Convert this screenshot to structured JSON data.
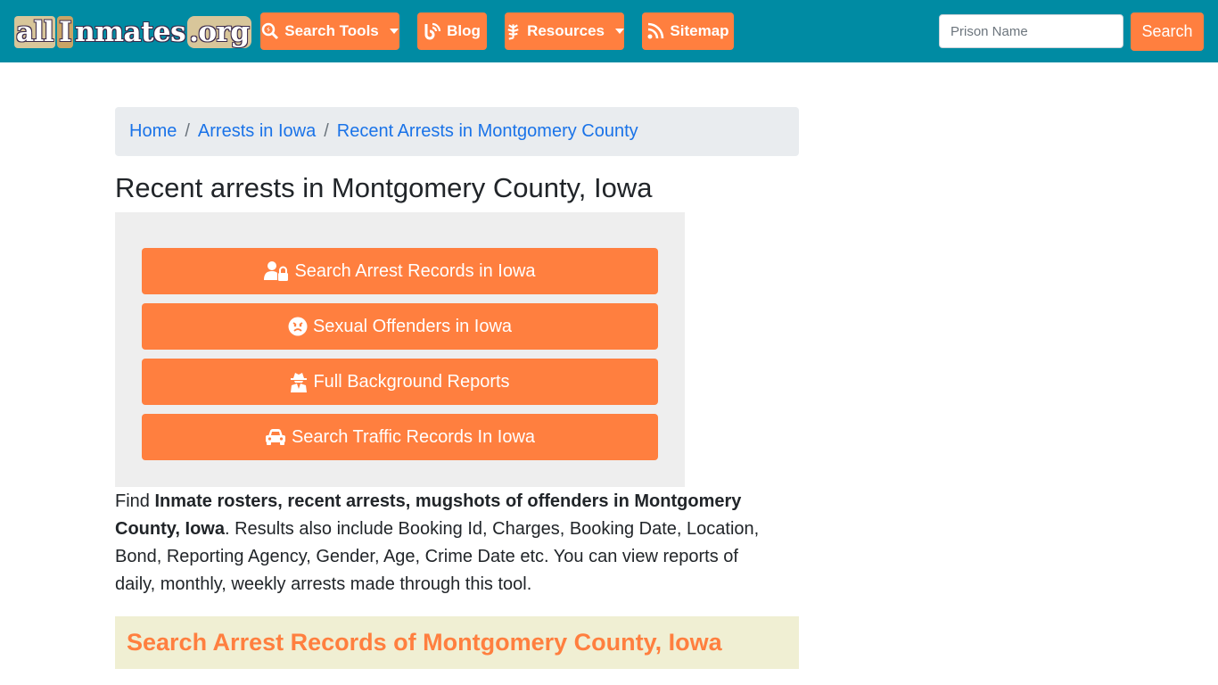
{
  "header": {
    "logo": {
      "part1": "all",
      "part2": "I",
      "part3": "nmates",
      "part4": ".org"
    },
    "nav": [
      {
        "label": "Search Tools",
        "icon": "search-icon",
        "dropdown": true
      },
      {
        "label": "Blog",
        "icon": "blog-icon",
        "dropdown": false
      },
      {
        "label": "Resources",
        "icon": "leaf-icon",
        "dropdown": true
      },
      {
        "label": "Sitemap",
        "icon": "rss-icon",
        "dropdown": false
      }
    ],
    "search": {
      "placeholder": "Prison Name",
      "value": "",
      "button_label": "Search"
    }
  },
  "breadcrumb": [
    {
      "label": "Home"
    },
    {
      "label": "Arrests in Iowa"
    },
    {
      "label": "Recent Arrests in Montgomery County"
    }
  ],
  "breadcrumb_separator": "/",
  "page_title": "Recent arrests in Montgomery County, Iowa",
  "actions": [
    {
      "label": "Search Arrest Records in Iowa",
      "icon": "user-lock-icon"
    },
    {
      "label": "Sexual Offenders in Iowa",
      "icon": "angry-face-icon"
    },
    {
      "label": "Full Background Reports",
      "icon": "user-secret-icon"
    },
    {
      "label": "Search Traffic Records In Iowa",
      "icon": "car-icon"
    }
  ],
  "description": {
    "lead": "Find ",
    "bold": "Inmate rosters, recent arrests, mugshots of offenders in Montgomery County, Iowa",
    "rest": ". Results also include Booking Id, Charges, Booking Date, Location, Bond, Reporting Agency, Gender, Age, Crime Date etc. You can view reports of daily, monthly, weekly arrests made through this tool."
  },
  "section_heading": "Search Arrest Records of Montgomery County, Iowa",
  "colors": {
    "header_bg": "#008ba3",
    "accent": "#ff7f3f",
    "link": "#1a73e8",
    "section_bg": "#f0efd3"
  }
}
